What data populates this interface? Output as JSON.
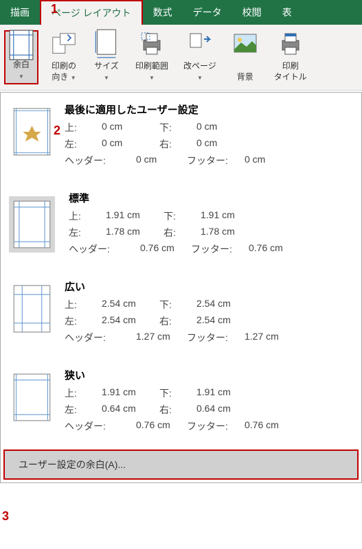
{
  "step_numbers": {
    "n1": "1",
    "n2": "2",
    "n3": "3"
  },
  "tabs": {
    "draw": "描画",
    "page_layout": "ページ レイアウト",
    "formulas": "数式",
    "data": "データ",
    "review": "校閲",
    "view": "表"
  },
  "toolbar": {
    "margins": "余白",
    "orientation": "印刷の\n向き",
    "size": "サイズ",
    "print_area": "印刷範囲",
    "breaks": "改ページ",
    "background": "背景",
    "print_titles": "印刷\nタイトル"
  },
  "options": {
    "last_custom": {
      "title": "最後に適用したユーザー設定",
      "top_l": "上:",
      "top_v": "0 cm",
      "bot_l": "下:",
      "bot_v": "0 cm",
      "left_l": "左:",
      "left_v": "0 cm",
      "right_l": "右:",
      "right_v": "0 cm",
      "hdr_l": "ヘッダー:",
      "hdr_v": "0 cm",
      "ftr_l": "フッター:",
      "ftr_v": "0 cm"
    },
    "normal": {
      "title": "標準",
      "top_l": "上:",
      "top_v": "1.91 cm",
      "bot_l": "下:",
      "bot_v": "1.91 cm",
      "left_l": "左:",
      "left_v": "1.78 cm",
      "right_l": "右:",
      "right_v": "1.78 cm",
      "hdr_l": "ヘッダー:",
      "hdr_v": "0.76 cm",
      "ftr_l": "フッター:",
      "ftr_v": "0.76 cm"
    },
    "wide": {
      "title": "広い",
      "top_l": "上:",
      "top_v": "2.54 cm",
      "bot_l": "下:",
      "bot_v": "2.54 cm",
      "left_l": "左:",
      "left_v": "2.54 cm",
      "right_l": "右:",
      "right_v": "2.54 cm",
      "hdr_l": "ヘッダー:",
      "hdr_v": "1.27 cm",
      "ftr_l": "フッター:",
      "ftr_v": "1.27 cm"
    },
    "narrow": {
      "title": "狭い",
      "top_l": "上:",
      "top_v": "1.91 cm",
      "bot_l": "下:",
      "bot_v": "1.91 cm",
      "left_l": "左:",
      "left_v": "0.64 cm",
      "right_l": "右:",
      "right_v": "0.64 cm",
      "hdr_l": "ヘッダー:",
      "hdr_v": "0.76 cm",
      "ftr_l": "フッター:",
      "ftr_v": "0.76 cm"
    }
  },
  "custom_margins": "ユーザー設定の余白(A)..."
}
